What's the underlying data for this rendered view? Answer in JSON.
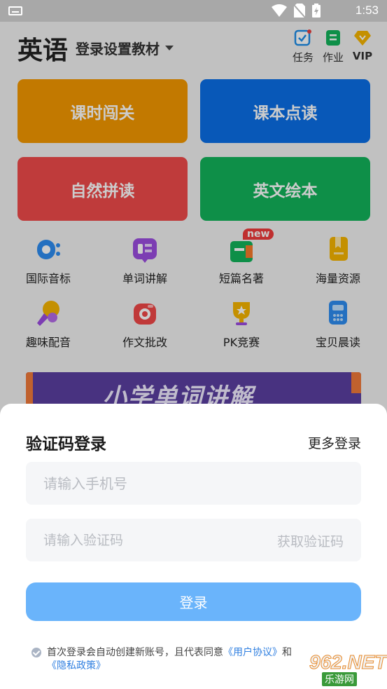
{
  "status_bar": {
    "time": "1:53"
  },
  "header": {
    "title": "英语",
    "book_select": "登录设置教材",
    "actions": [
      {
        "label": "任务",
        "icon": "task-check-icon"
      },
      {
        "label": "作业",
        "icon": "homework-icon"
      },
      {
        "label": "VIP",
        "icon": "diamond-icon"
      }
    ]
  },
  "big_buttons": [
    {
      "label": "课时闯关",
      "color": "#f39800"
    },
    {
      "label": "课本点读",
      "color": "#0a6ee6"
    },
    {
      "label": "自然拼读",
      "color": "#ef4a4a"
    },
    {
      "label": "英文绘本",
      "color": "#12b35a"
    }
  ],
  "grid": [
    {
      "label": "国际音标",
      "icon": "phonetic-icon"
    },
    {
      "label": "单词讲解",
      "icon": "word-card-icon"
    },
    {
      "label": "短篇名著",
      "icon": "book-icon",
      "badge": "new"
    },
    {
      "label": "海量资源",
      "icon": "resource-icon"
    },
    {
      "label": "趣味配音",
      "icon": "microphone-icon"
    },
    {
      "label": "作文批改",
      "icon": "camera-icon"
    },
    {
      "label": "PK竞赛",
      "icon": "trophy-icon"
    },
    {
      "label": "宝贝晨读",
      "icon": "reader-icon"
    }
  ],
  "banner": {
    "text": "小学单词讲解"
  },
  "login_sheet": {
    "title": "验证码登录",
    "more_login": "更多登录",
    "phone_placeholder": "请输入手机号",
    "code_placeholder": "请输入验证码",
    "get_code": "获取验证码",
    "login_button": "登录",
    "agreement_prefix": "首次登录会自动创建新账号，且代表同意",
    "user_agreement": "《用户协议》",
    "and": "和",
    "privacy_policy": "《隐私政策》"
  },
  "watermark": {
    "number": "962.NET",
    "sub": "乐游网"
  }
}
